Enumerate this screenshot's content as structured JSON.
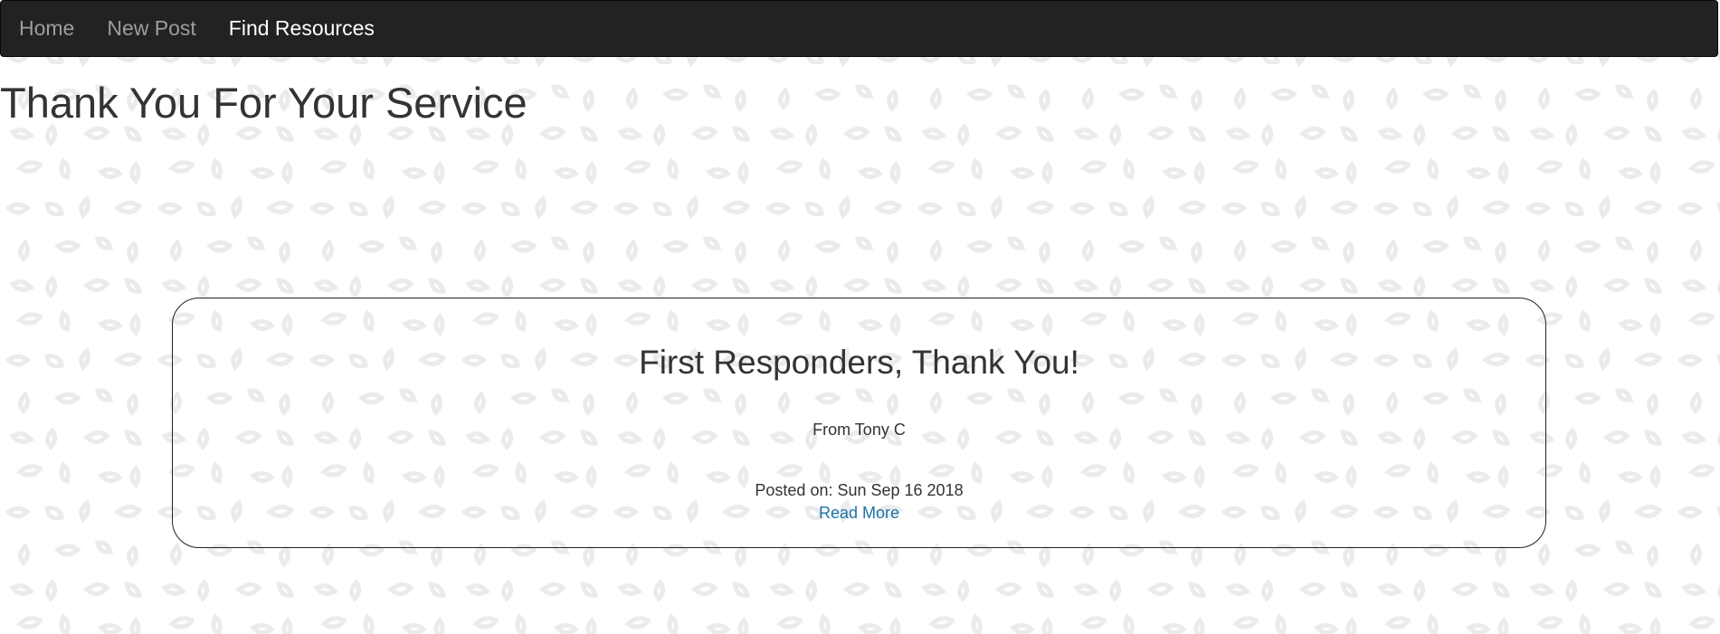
{
  "nav": {
    "items": [
      {
        "label": "Home",
        "active": false
      },
      {
        "label": "New Post",
        "active": false
      },
      {
        "label": "Find Resources",
        "active": true
      }
    ]
  },
  "page": {
    "title": "Thank You For Your Service"
  },
  "post": {
    "title": "First Responders, Thank You!",
    "author": "From Tony C",
    "posted": "Posted on: Sun Sep 16 2018",
    "read_more": "Read More"
  },
  "colors": {
    "navbar_bg": "#222222",
    "nav_text": "#9d9d9d",
    "nav_active_text": "#ffffff",
    "link": "#1a73a8",
    "background_pattern": "#ececec"
  }
}
